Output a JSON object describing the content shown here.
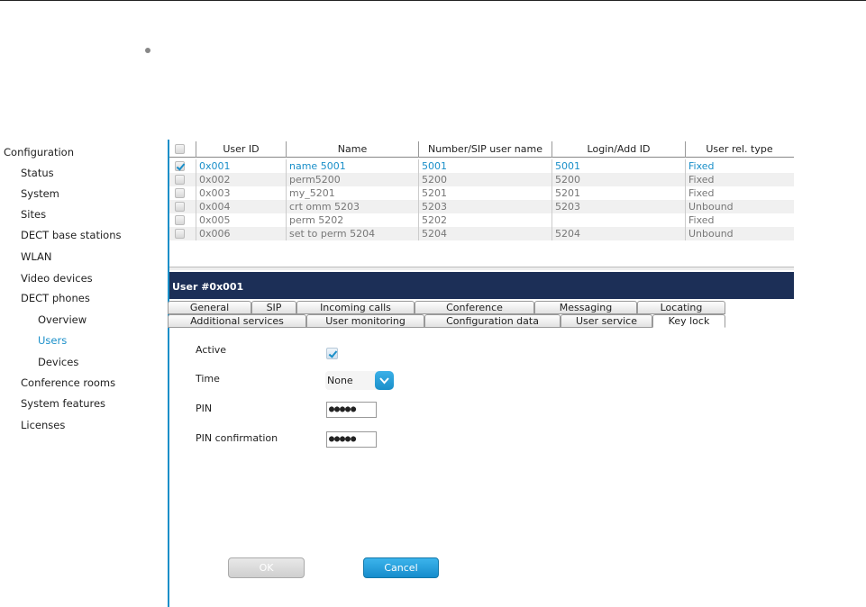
{
  "sidebar": {
    "items": [
      {
        "label": "Configuration",
        "level": 0
      },
      {
        "label": "Status",
        "level": 1
      },
      {
        "label": "System",
        "level": 1
      },
      {
        "label": "Sites",
        "level": 1
      },
      {
        "label": "DECT base stations",
        "level": 1
      },
      {
        "label": "WLAN",
        "level": 1
      },
      {
        "label": "Video devices",
        "level": 1
      },
      {
        "label": "DECT phones",
        "level": 1
      },
      {
        "label": "Overview",
        "level": 2
      },
      {
        "label": "Users",
        "level": 2,
        "active": true
      },
      {
        "label": "Devices",
        "level": 2
      },
      {
        "label": "Conference rooms",
        "level": 1
      },
      {
        "label": "System features",
        "level": 1
      },
      {
        "label": "Licenses",
        "level": 1
      }
    ]
  },
  "table": {
    "columns": [
      "User ID",
      "Name",
      "Number/SIP user name",
      "Login/Add ID",
      "User rel. type"
    ],
    "rows": [
      {
        "checked": true,
        "id": "0x001",
        "name": "name 5001",
        "number": "5001",
        "login": "5001",
        "type": "Fixed"
      },
      {
        "checked": false,
        "id": "0x002",
        "name": "perm5200",
        "number": "5200",
        "login": "5200",
        "type": "Fixed"
      },
      {
        "checked": false,
        "id": "0x003",
        "name": "my_5201",
        "number": "5201",
        "login": "5201",
        "type": "Fixed"
      },
      {
        "checked": false,
        "id": "0x004",
        "name": "crt omm 5203",
        "number": "5203",
        "login": "5203",
        "type": "Unbound"
      },
      {
        "checked": false,
        "id": "0x005",
        "name": "perm 5202",
        "number": "5202",
        "login": "",
        "type": "Fixed"
      },
      {
        "checked": false,
        "id": "0x006",
        "name": "set to perm 5204",
        "number": "5204",
        "login": "5204",
        "type": "Unbound"
      }
    ]
  },
  "detail": {
    "title": "User #0x001",
    "tabs_row1": [
      "General",
      "SIP",
      "Incoming calls",
      "Conference",
      "Messaging",
      "Locating"
    ],
    "tabs_row2": [
      "Additional services",
      "User monitoring",
      "Configuration data",
      "User service",
      "Key lock"
    ],
    "active_tab": "Key lock",
    "form": {
      "active_label": "Active",
      "active_checked": true,
      "time_label": "Time",
      "time_value": "None",
      "pin_label": "PIN",
      "pin_value": "●●●●●",
      "pin_confirm_label": "PIN confirmation",
      "pin_confirm_value": "●●●●●"
    },
    "buttons": {
      "ok": "OK",
      "cancel": "Cancel"
    }
  },
  "colors": {
    "accent": "#1a8fc9",
    "header_bg": "#1c2f57"
  }
}
